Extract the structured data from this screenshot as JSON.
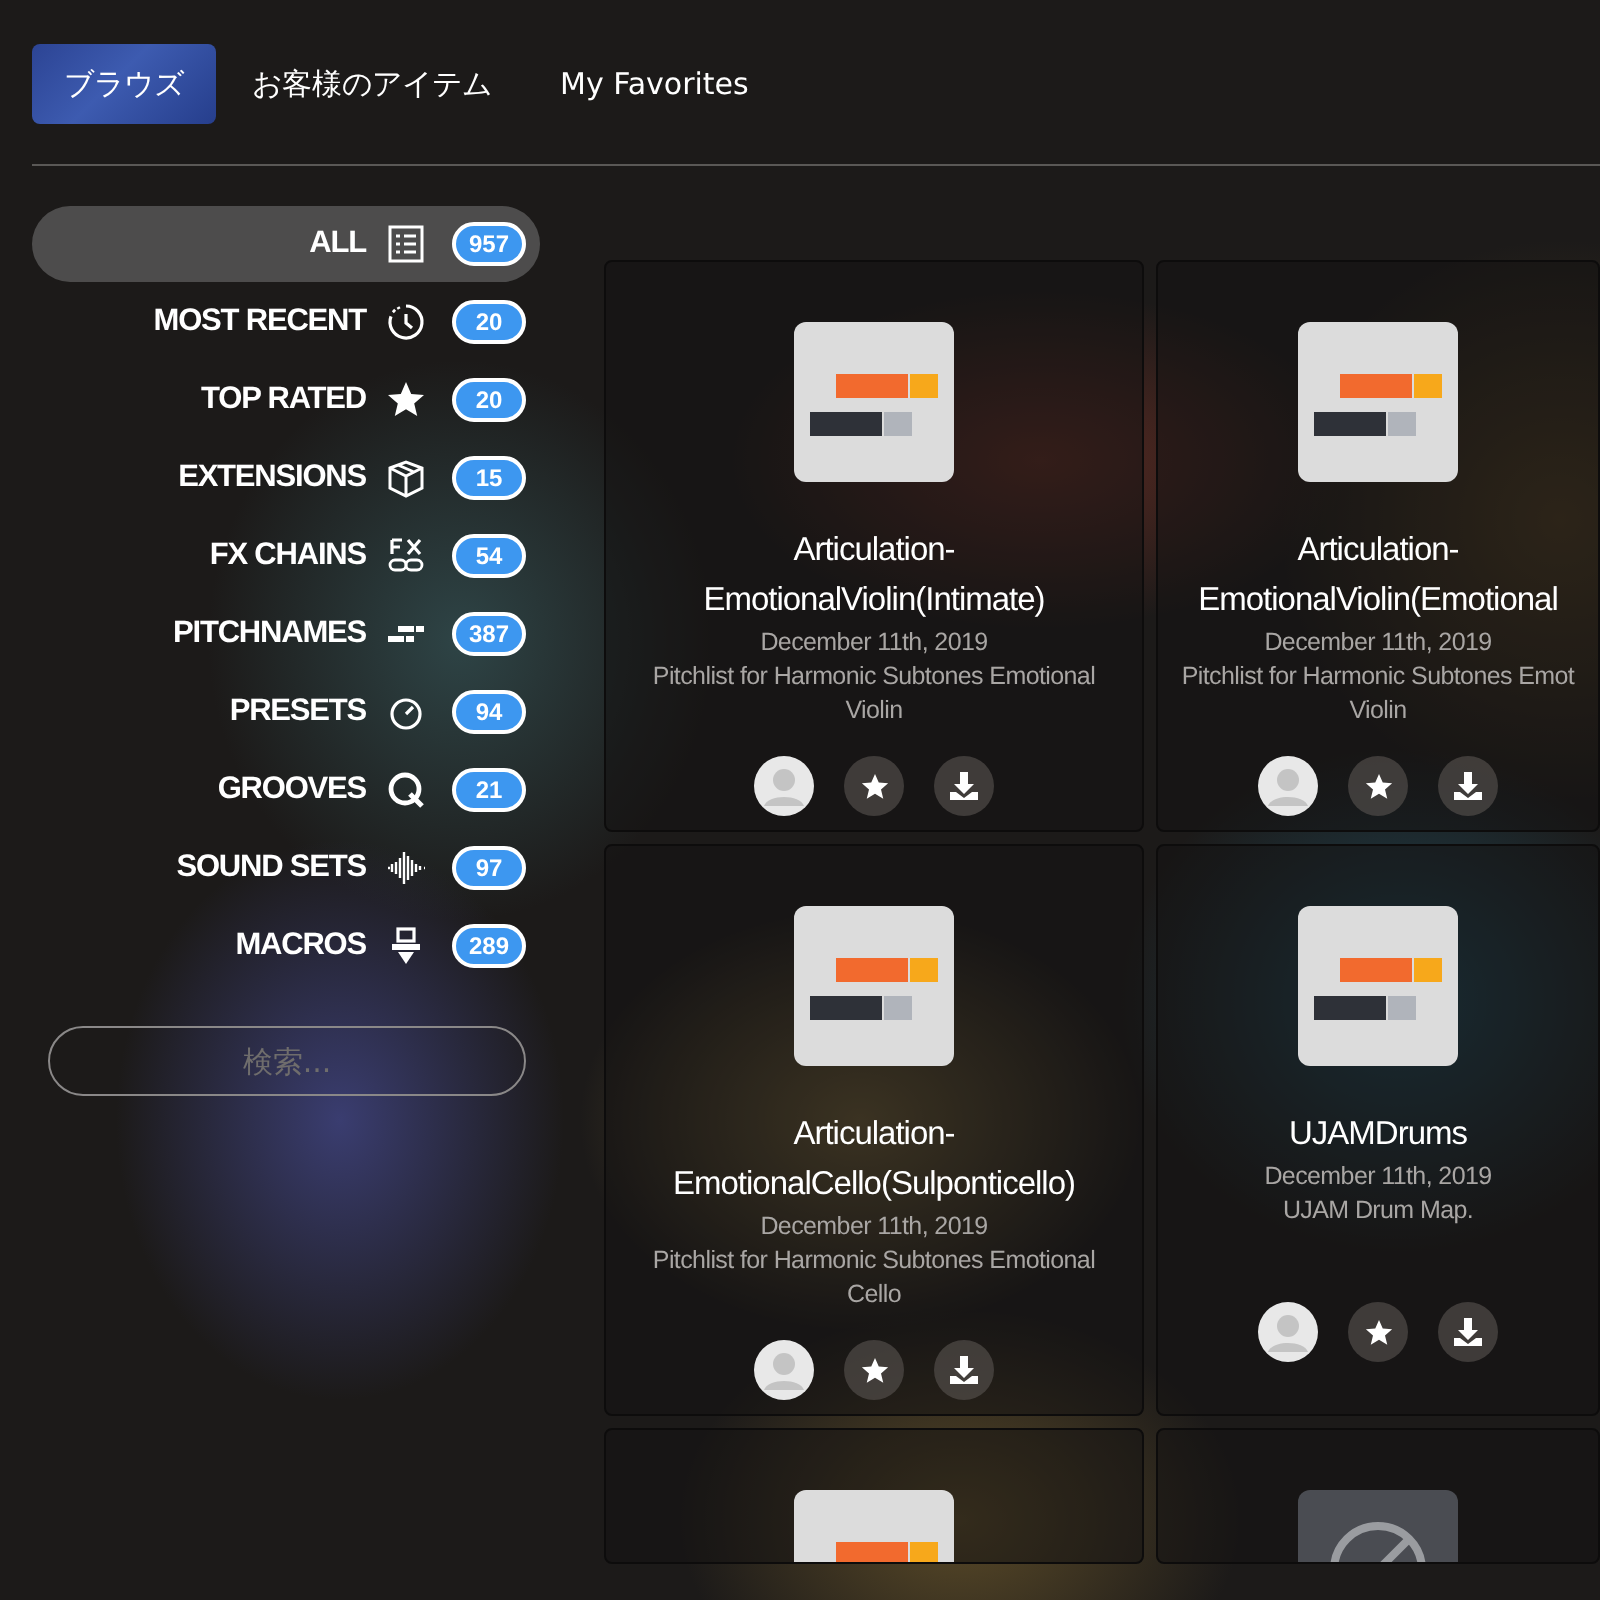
{
  "tabs": [
    {
      "label": "ブラウズ",
      "selected": true
    },
    {
      "label": "お客様のアイテム",
      "selected": false
    },
    {
      "label": "My Favorites",
      "selected": false
    }
  ],
  "sidebar": {
    "items": [
      {
        "label": "ALL",
        "kind": "list",
        "count": "957",
        "selected": true
      },
      {
        "label": "MOST RECENT",
        "kind": "clock",
        "count": "20",
        "selected": false
      },
      {
        "label": "TOP RATED",
        "kind": "star",
        "count": "20",
        "selected": false
      },
      {
        "label": "EXTENSIONS",
        "kind": "box",
        "count": "15",
        "selected": false
      },
      {
        "label": "FX CHAINS",
        "kind": "fx",
        "count": "54",
        "selected": false
      },
      {
        "label": "PITCHNAMES",
        "kind": "bars",
        "count": "387",
        "selected": false
      },
      {
        "label": "PRESETS",
        "kind": "dial",
        "count": "94",
        "selected": false
      },
      {
        "label": "GROOVES",
        "kind": "q",
        "count": "21",
        "selected": false
      },
      {
        "label": "SOUND SETS",
        "kind": "wave",
        "count": "97",
        "selected": false
      },
      {
        "label": "MACROS",
        "kind": "macro",
        "count": "289",
        "selected": false
      }
    ],
    "search": {
      "placeholder": "検索..."
    }
  },
  "cards": [
    {
      "kind": "pitchlist",
      "title": "Articulation-EmotionalViolin(Intimate)",
      "date": "December 11th, 2019",
      "description": "Pitchlist for Harmonic Subtones Emotional Violin"
    },
    {
      "kind": "pitchlist",
      "title": "Articulation-EmotionalViolin(Emotional",
      "date": "December 11th, 2019",
      "description": "Pitchlist for Harmonic Subtones Emot Violin"
    },
    {
      "kind": "pitchlist",
      "title": "Articulation-EmotionalCello(Sulponticello)",
      "date": "December 11th, 2019",
      "description": "Pitchlist for Harmonic Subtones Emotional Cello"
    },
    {
      "kind": "pitchlist",
      "title": "UJAMDrums",
      "date": "December 11th, 2019",
      "description": "UJAM Drum Map."
    },
    {
      "kind": "pitchlist"
    },
    {
      "kind": "blocked"
    }
  ]
}
